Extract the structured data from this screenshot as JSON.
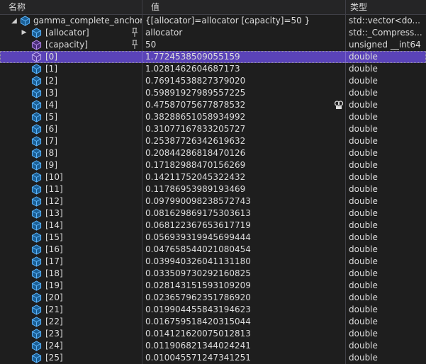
{
  "header": {
    "name": "名称",
    "value": "值",
    "type": "类型"
  },
  "root": {
    "name": "gamma_complete_anchor",
    "value": "{[allocator]=allocator [capacity]=50 }",
    "type": "std::vector<do...",
    "icon": "variable-cube-icon"
  },
  "allocator": {
    "name": "[allocator]",
    "value": "allocator",
    "type": "std::_Compress...",
    "icon": "variable-cube-icon"
  },
  "capacity": {
    "name": "[capacity]",
    "value": "50",
    "type": "unsigned __int64",
    "icon": "field-cube-icon"
  },
  "elements": [
    {
      "name": "[0]",
      "value": "1.7724538509055159",
      "type": "double"
    },
    {
      "name": "[1]",
      "value": "1.0281462604687173",
      "type": "double"
    },
    {
      "name": "[2]",
      "value": "0.76914538827379020",
      "type": "double"
    },
    {
      "name": "[3]",
      "value": "0.59891927989557225",
      "type": "double"
    },
    {
      "name": "[4]",
      "value": "0.47587075677878532",
      "type": "double"
    },
    {
      "name": "[5]",
      "value": "0.38288651058934992",
      "type": "double"
    },
    {
      "name": "[6]",
      "value": "0.31077167833205727",
      "type": "double"
    },
    {
      "name": "[7]",
      "value": "0.25387726342619632",
      "type": "double"
    },
    {
      "name": "[8]",
      "value": "0.20844286818470126",
      "type": "double"
    },
    {
      "name": "[9]",
      "value": "0.17182988470156269",
      "type": "double"
    },
    {
      "name": "[10]",
      "value": "0.14211752045322432",
      "type": "double"
    },
    {
      "name": "[11]",
      "value": "0.11786953989193469",
      "type": "double"
    },
    {
      "name": "[12]",
      "value": "0.097990098238572743",
      "type": "double"
    },
    {
      "name": "[13]",
      "value": "0.081629869175303613",
      "type": "double"
    },
    {
      "name": "[14]",
      "value": "0.068122367653617719",
      "type": "double"
    },
    {
      "name": "[15]",
      "value": "0.056939319945699444",
      "type": "double"
    },
    {
      "name": "[16]",
      "value": "0.047658544021080454",
      "type": "double"
    },
    {
      "name": "[17]",
      "value": "0.039940326041131180",
      "type": "double"
    },
    {
      "name": "[18]",
      "value": "0.033509730292160825",
      "type": "double"
    },
    {
      "name": "[19]",
      "value": "0.028143151593109209",
      "type": "double"
    },
    {
      "name": "[20]",
      "value": "0.023657962351786920",
      "type": "double"
    },
    {
      "name": "[21]",
      "value": "0.019904455843194623",
      "type": "double"
    },
    {
      "name": "[22]",
      "value": "0.016759518420315044",
      "type": "double"
    },
    {
      "name": "[23]",
      "value": "0.014121620075012813",
      "type": "double"
    },
    {
      "name": "[24]",
      "value": "0.011906821344024241",
      "type": "double"
    },
    {
      "name": "[25]",
      "value": "0.010045571247341251",
      "type": "double"
    }
  ],
  "selected_index": 0,
  "colors": {
    "background": "#1e1e1e",
    "header": "#252526",
    "selection": "#5a43b8",
    "icon_blue": "#1e8ed8",
    "icon_purple": "#a37fd9"
  }
}
